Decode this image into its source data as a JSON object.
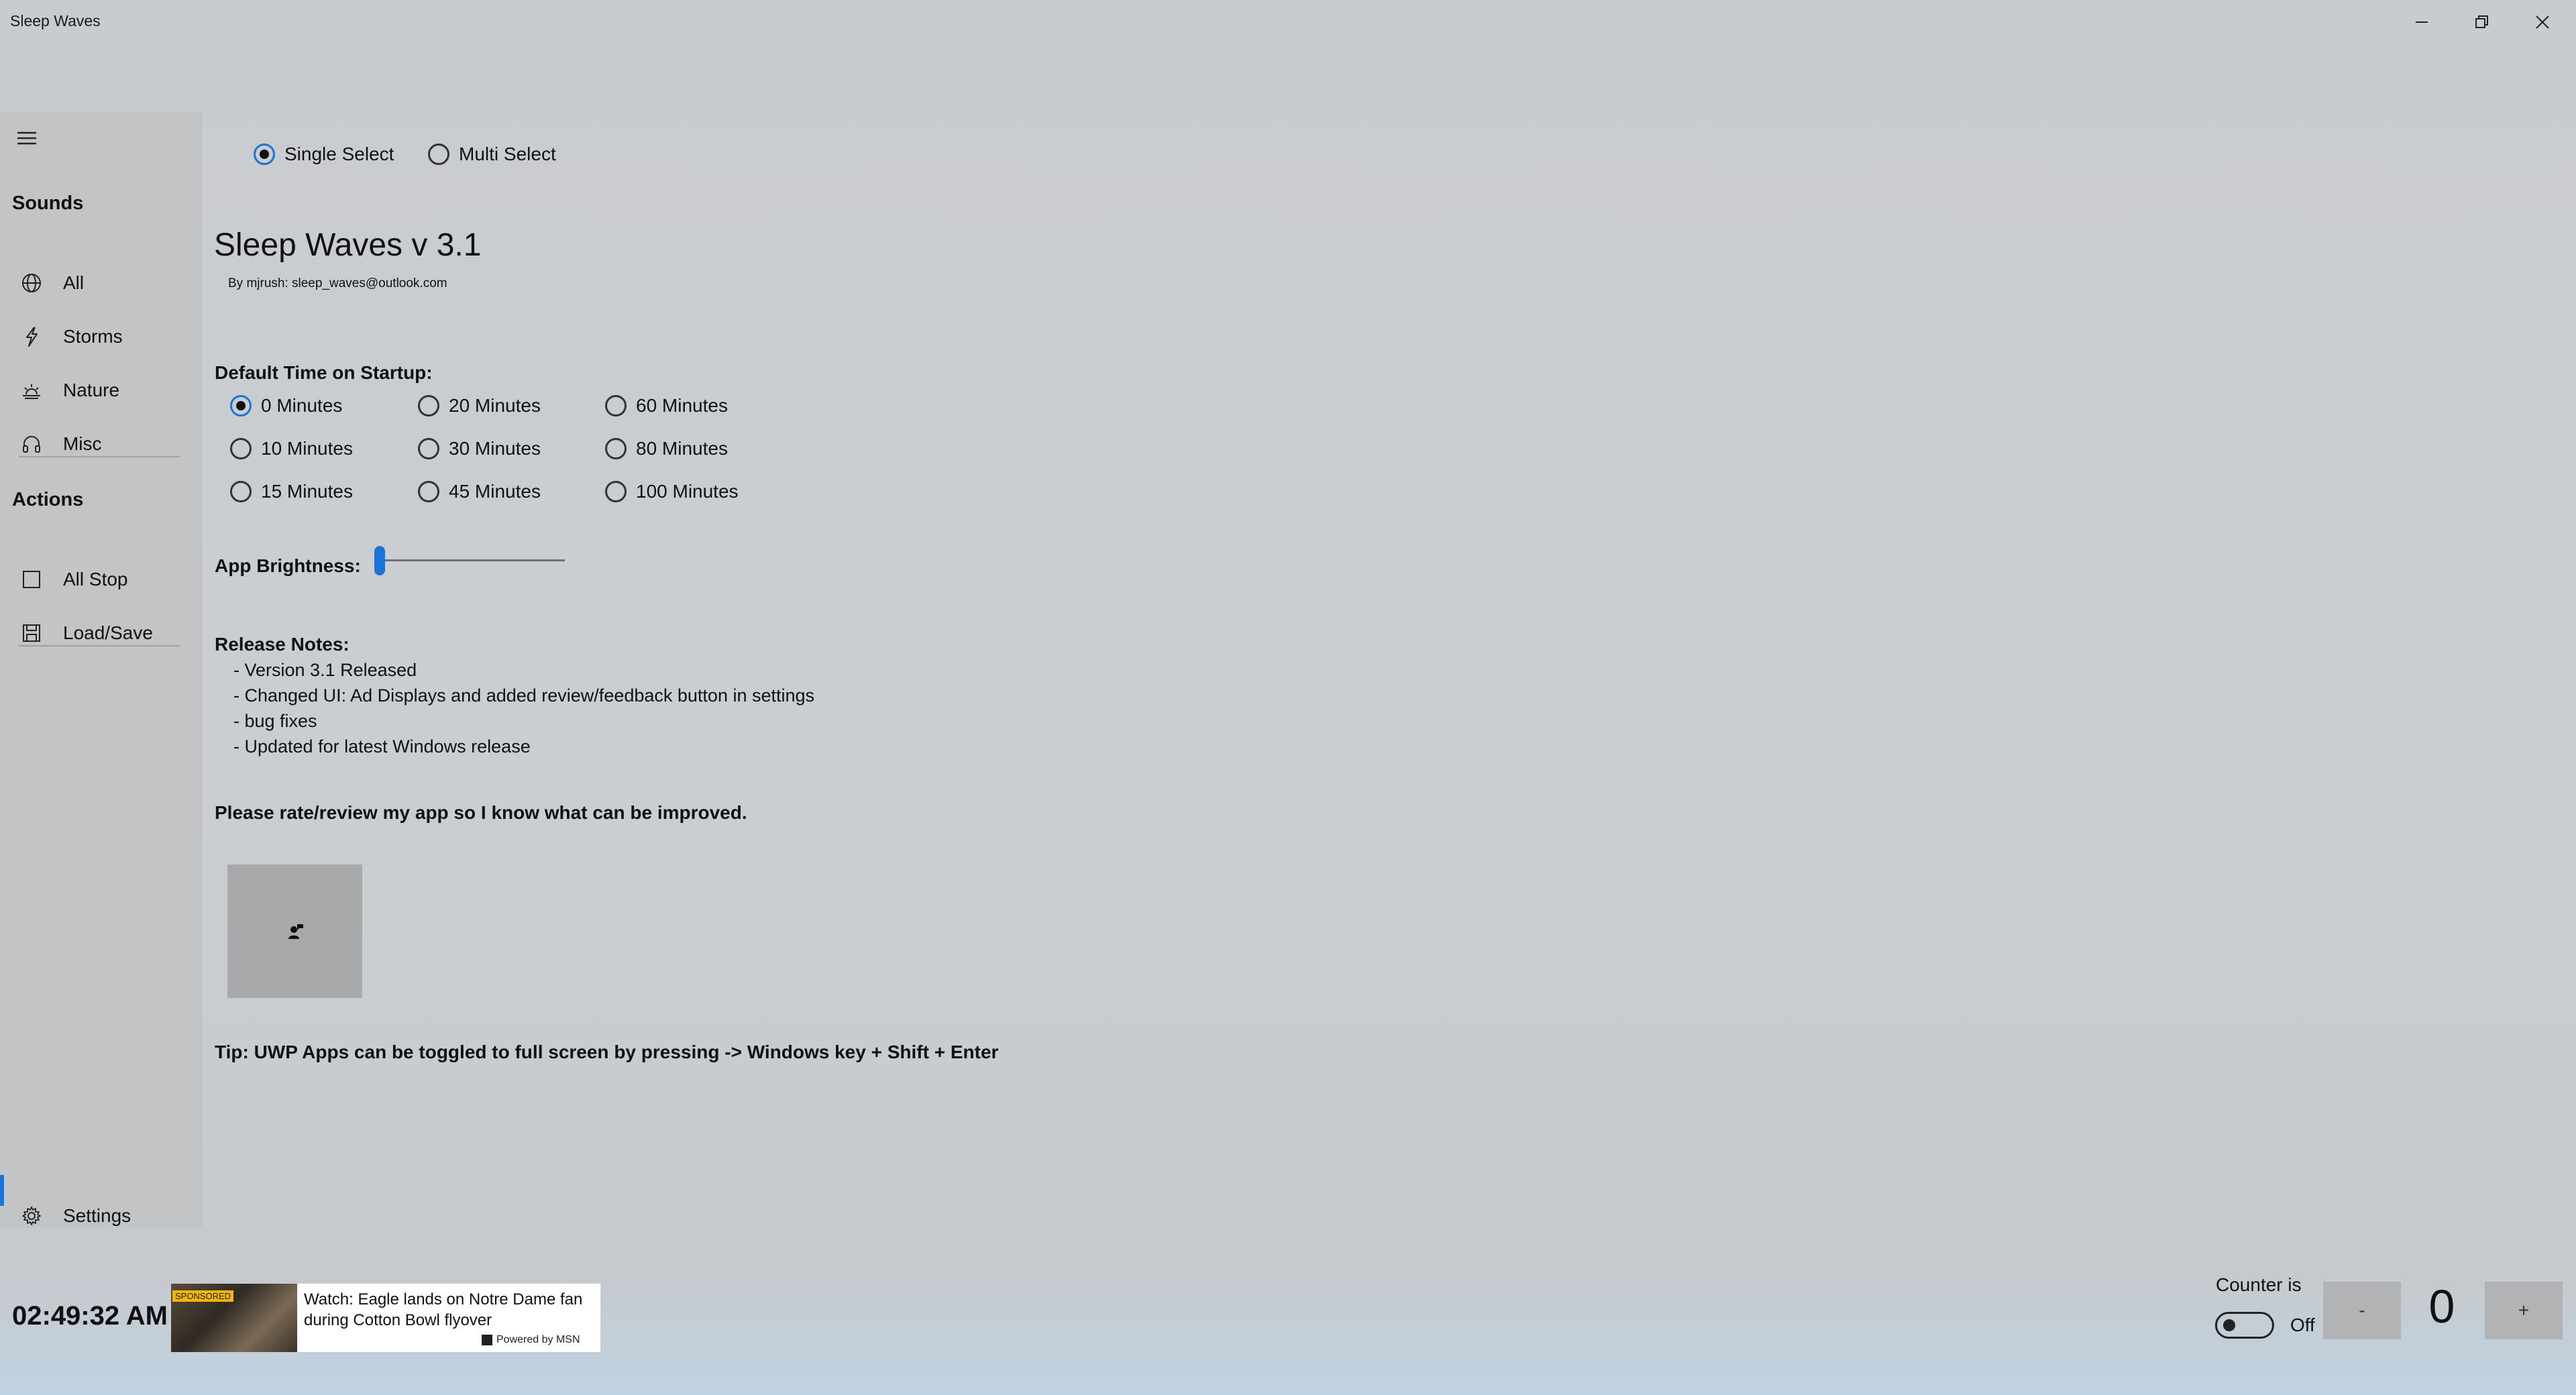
{
  "window": {
    "title": "Sleep Waves"
  },
  "nav": {
    "sections": [
      {
        "heading": "Sounds",
        "items": [
          {
            "label": "All",
            "icon": "globe-icon"
          },
          {
            "label": "Storms",
            "icon": "lightning-icon"
          },
          {
            "label": "Nature",
            "icon": "sunset-icon"
          },
          {
            "label": "Misc",
            "icon": "headphones-icon"
          }
        ]
      },
      {
        "heading": "Actions",
        "items": [
          {
            "label": "All Stop",
            "icon": "checkbox-icon"
          },
          {
            "label": "Load/Save",
            "icon": "save-icon"
          }
        ]
      }
    ],
    "settings_label": "Settings",
    "selected": "Settings"
  },
  "select_mode": {
    "options": [
      "Single Select",
      "Multi Select"
    ],
    "selected": "Single Select"
  },
  "settings": {
    "title": "Sleep Waves v 3.1",
    "byline": "By mjrush: sleep_waves@outlook.com",
    "default_time": {
      "label": "Default Time on Startup:",
      "options": [
        "0 Minutes",
        "10 Minutes",
        "15 Minutes",
        "20 Minutes",
        "30 Minutes",
        "45 Minutes",
        "60 Minutes",
        "80 Minutes",
        "100 Minutes"
      ],
      "selected": "0 Minutes"
    },
    "brightness": {
      "label": "App Brightness:",
      "value": 0
    },
    "release_notes": {
      "heading": "Release Notes:",
      "lines": [
        "- Version 3.1 Released",
        "- Changed UI: Ad Displays and added review/feedback button in settings",
        "- bug fixes",
        "- Updated for latest Windows release"
      ]
    },
    "review_prompt": "Please rate/review my app so I know what can be improved.",
    "review_icon": "feedback-icon",
    "tip": "Tip: UWP Apps can be toggled to full screen by pressing -> Windows key + Shift + Enter"
  },
  "footer": {
    "clock": "02:49:32 AM",
    "ad": {
      "badge": "SPONSORED",
      "headline": "Watch: Eagle lands on Notre Dame fan during Cotton Bowl flyover",
      "powered_by": "Powered by MSN"
    },
    "counter": {
      "label": "Counter is",
      "state": "Off",
      "toggle_on": false,
      "minus_label": "-",
      "plus_label": "+",
      "value": "0"
    }
  },
  "colors": {
    "accent": "#1a73d9",
    "background": "#c9cccf",
    "nav_background": "#c2c4c6"
  }
}
